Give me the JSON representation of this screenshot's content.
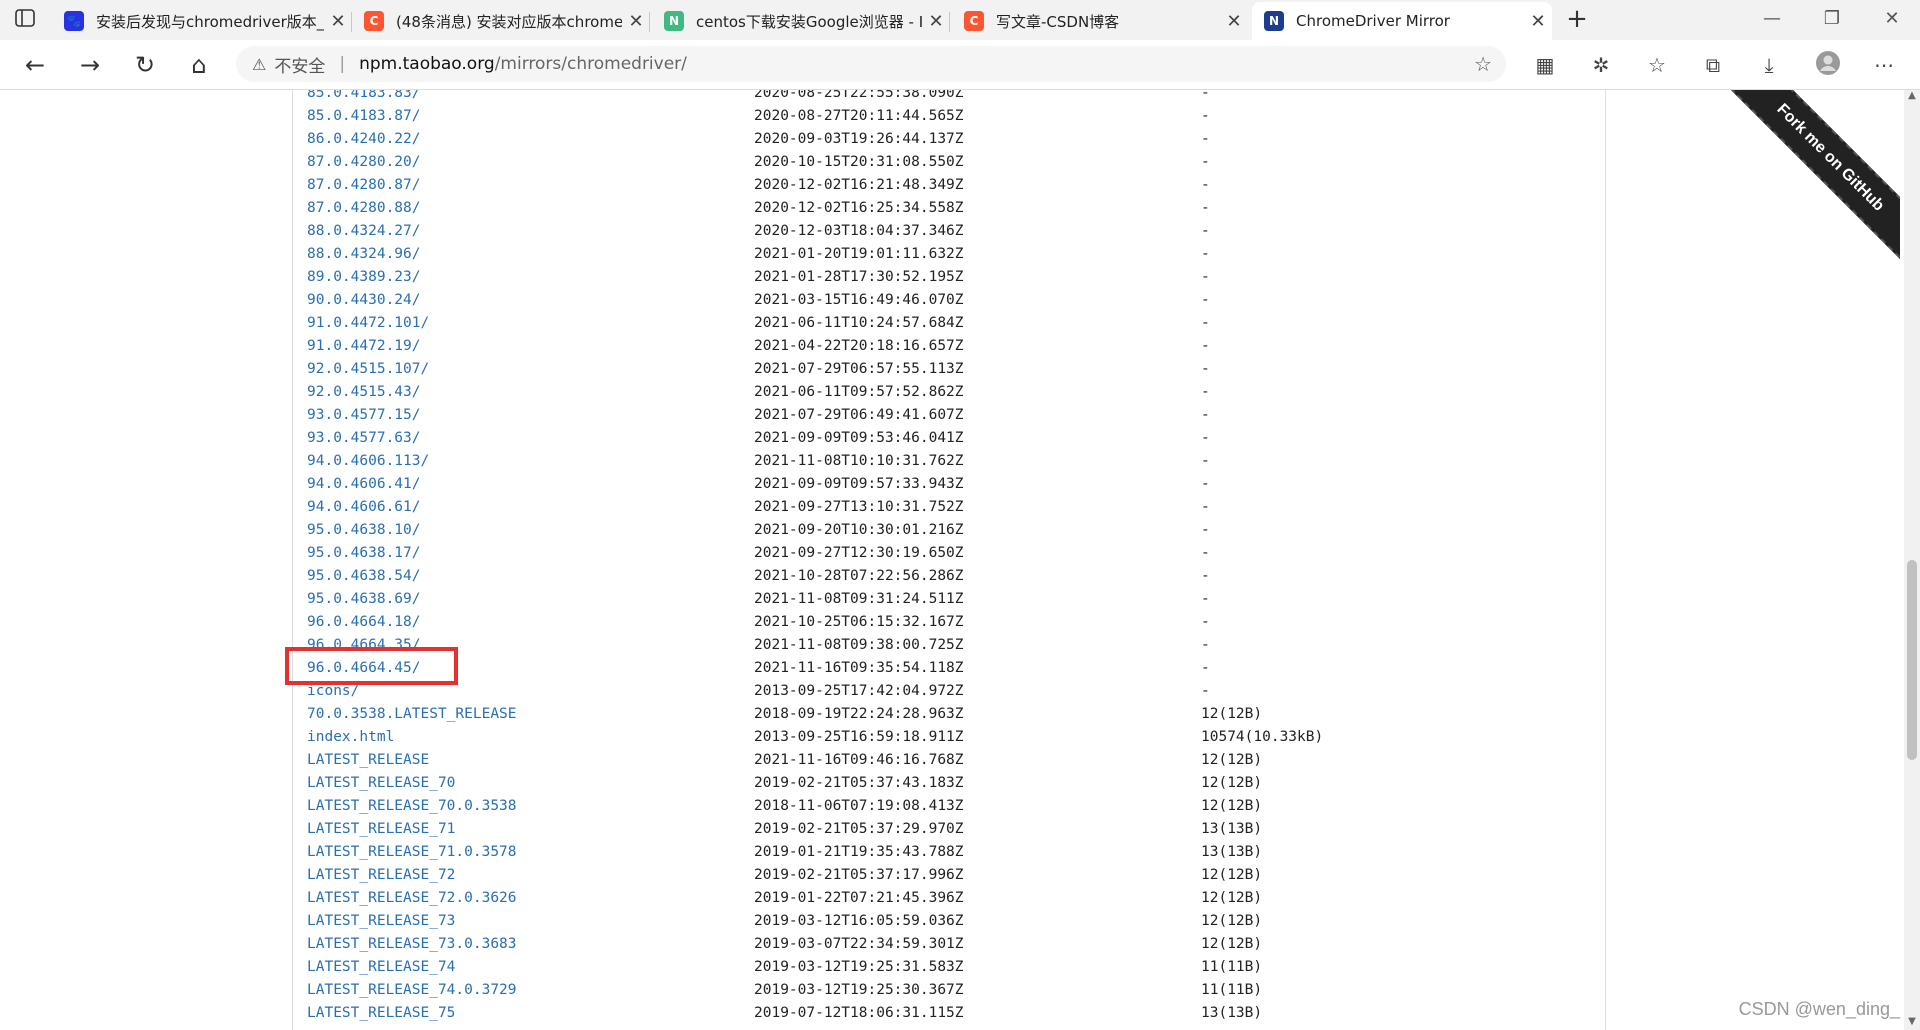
{
  "tabs": [
    {
      "title": "安装后发现与chromedriver版本_",
      "icon": "baidu-paw-icon",
      "color": "#2932e1",
      "glyph": "🐾"
    },
    {
      "title": "(48条消息) 安装对应版本chrome",
      "icon": "csdn-c-icon",
      "color": "#fc5531",
      "glyph": "C"
    },
    {
      "title": "centos下载安装Google浏览器 - I",
      "icon": "n-green-icon",
      "color": "#42b883",
      "glyph": "N"
    },
    {
      "title": "写文章-CSDN博客",
      "icon": "csdn-c-icon",
      "color": "#fc5531",
      "glyph": "C"
    },
    {
      "title": "ChromeDriver Mirror",
      "icon": "n-npm-icon",
      "color": "#1e3c8c",
      "glyph": "N"
    }
  ],
  "omnibox": {
    "warning_icon": "⚠",
    "insecure_label": "不安全",
    "separator": "|",
    "host": "npm.taobao.org",
    "path": "/mirrors/chromedriver/"
  },
  "ribbon_text": "Fork me on GitHub",
  "watermark": "CSDN @wen_ding_",
  "rows": [
    {
      "name": "85.0.4183.83/",
      "date": "2020-08-25T22:55:38.090Z",
      "size": "-"
    },
    {
      "name": "85.0.4183.87/",
      "date": "2020-08-27T20:11:44.565Z",
      "size": "-"
    },
    {
      "name": "86.0.4240.22/",
      "date": "2020-09-03T19:26:44.137Z",
      "size": "-"
    },
    {
      "name": "87.0.4280.20/",
      "date": "2020-10-15T20:31:08.550Z",
      "size": "-"
    },
    {
      "name": "87.0.4280.87/",
      "date": "2020-12-02T16:21:48.349Z",
      "size": "-"
    },
    {
      "name": "87.0.4280.88/",
      "date": "2020-12-02T16:25:34.558Z",
      "size": "-"
    },
    {
      "name": "88.0.4324.27/",
      "date": "2020-12-03T18:04:37.346Z",
      "size": "-"
    },
    {
      "name": "88.0.4324.96/",
      "date": "2021-01-20T19:01:11.632Z",
      "size": "-"
    },
    {
      "name": "89.0.4389.23/",
      "date": "2021-01-28T17:30:52.195Z",
      "size": "-"
    },
    {
      "name": "90.0.4430.24/",
      "date": "2021-03-15T16:49:46.070Z",
      "size": "-"
    },
    {
      "name": "91.0.4472.101/",
      "date": "2021-06-11T10:24:57.684Z",
      "size": "-"
    },
    {
      "name": "91.0.4472.19/",
      "date": "2021-04-22T20:18:16.657Z",
      "size": "-"
    },
    {
      "name": "92.0.4515.107/",
      "date": "2021-07-29T06:57:55.113Z",
      "size": "-"
    },
    {
      "name": "92.0.4515.43/",
      "date": "2021-06-11T09:57:52.862Z",
      "size": "-"
    },
    {
      "name": "93.0.4577.15/",
      "date": "2021-07-29T06:49:41.607Z",
      "size": "-"
    },
    {
      "name": "93.0.4577.63/",
      "date": "2021-09-09T09:53:46.041Z",
      "size": "-"
    },
    {
      "name": "94.0.4606.113/",
      "date": "2021-11-08T10:10:31.762Z",
      "size": "-"
    },
    {
      "name": "94.0.4606.41/",
      "date": "2021-09-09T09:57:33.943Z",
      "size": "-"
    },
    {
      "name": "94.0.4606.61/",
      "date": "2021-09-27T13:10:31.752Z",
      "size": "-"
    },
    {
      "name": "95.0.4638.10/",
      "date": "2021-09-20T10:30:01.216Z",
      "size": "-"
    },
    {
      "name": "95.0.4638.17/",
      "date": "2021-09-27T12:30:19.650Z",
      "size": "-"
    },
    {
      "name": "95.0.4638.54/",
      "date": "2021-10-28T07:22:56.286Z",
      "size": "-"
    },
    {
      "name": "95.0.4638.69/",
      "date": "2021-11-08T09:31:24.511Z",
      "size": "-"
    },
    {
      "name": "96.0.4664.18/",
      "date": "2021-10-25T06:15:32.167Z",
      "size": "-"
    },
    {
      "name": "96.0.4664.35/",
      "date": "2021-11-08T09:38:00.725Z",
      "size": "-"
    },
    {
      "name": "96.0.4664.45/",
      "date": "2021-11-16T09:35:54.118Z",
      "size": "-"
    },
    {
      "name": "icons/",
      "date": "2013-09-25T17:42:04.972Z",
      "size": "-"
    },
    {
      "name": "70.0.3538.LATEST_RELEASE",
      "date": "2018-09-19T22:24:28.963Z",
      "size": "12(12B)"
    },
    {
      "name": "index.html",
      "date": "2013-09-25T16:59:18.911Z",
      "size": "10574(10.33kB)"
    },
    {
      "name": "LATEST_RELEASE",
      "date": "2021-11-16T09:46:16.768Z",
      "size": "12(12B)"
    },
    {
      "name": "LATEST_RELEASE_70",
      "date": "2019-02-21T05:37:43.183Z",
      "size": "12(12B)"
    },
    {
      "name": "LATEST_RELEASE_70.0.3538",
      "date": "2018-11-06T07:19:08.413Z",
      "size": "12(12B)"
    },
    {
      "name": "LATEST_RELEASE_71",
      "date": "2019-02-21T05:37:29.970Z",
      "size": "13(13B)"
    },
    {
      "name": "LATEST_RELEASE_71.0.3578",
      "date": "2019-01-21T19:35:43.788Z",
      "size": "13(13B)"
    },
    {
      "name": "LATEST_RELEASE_72",
      "date": "2019-02-21T05:37:17.996Z",
      "size": "12(12B)"
    },
    {
      "name": "LATEST_RELEASE_72.0.3626",
      "date": "2019-01-22T07:21:45.396Z",
      "size": "12(12B)"
    },
    {
      "name": "LATEST_RELEASE_73",
      "date": "2019-03-12T16:05:59.036Z",
      "size": "12(12B)"
    },
    {
      "name": "LATEST_RELEASE_73.0.3683",
      "date": "2019-03-07T22:34:59.301Z",
      "size": "12(12B)"
    },
    {
      "name": "LATEST_RELEASE_74",
      "date": "2019-03-12T19:25:31.583Z",
      "size": "11(11B)"
    },
    {
      "name": "LATEST_RELEASE_74.0.3729",
      "date": "2019-03-12T19:25:30.367Z",
      "size": "11(11B)"
    },
    {
      "name": "LATEST_RELEASE_75",
      "date": "2019-07-12T18:06:31.115Z",
      "size": "13(13B)"
    }
  ]
}
